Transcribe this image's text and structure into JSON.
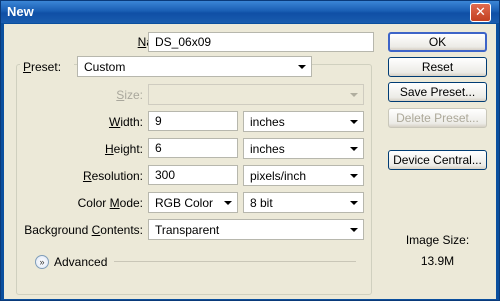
{
  "window": {
    "title": "New",
    "close_glyph": "✕"
  },
  "form": {
    "name_label": "Name:",
    "name_value": "DS_06x09",
    "preset_label": "Preset:",
    "preset_value": "Custom",
    "size_label": "Size:",
    "size_value": "",
    "width_label": "Width:",
    "width_value": "9",
    "width_unit": "inches",
    "height_label": "Height:",
    "height_value": "6",
    "height_unit": "inches",
    "resolution_label": "Resolution:",
    "resolution_value": "300",
    "resolution_unit": "pixels/inch",
    "color_mode_label": "Color Mode:",
    "color_mode_value": "RGB Color",
    "bit_depth_value": "8 bit",
    "background_label": "Background Contents:",
    "background_value": "Transparent",
    "advanced_label": "Advanced",
    "advanced_glyph": "»"
  },
  "buttons": {
    "ok": "OK",
    "reset": "Reset",
    "save_preset": "Save Preset...",
    "delete_preset": "Delete Preset...",
    "device_central": "Device Central..."
  },
  "image_size": {
    "label": "Image Size:",
    "value": "13.9M"
  }
}
